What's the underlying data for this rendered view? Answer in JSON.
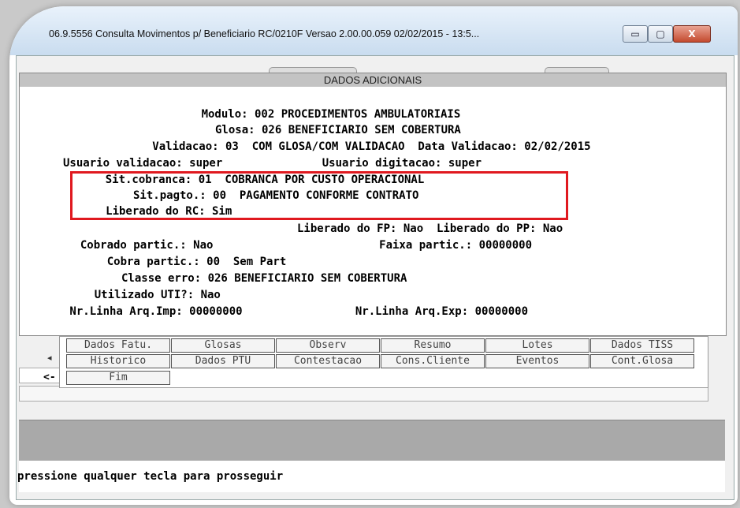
{
  "window": {
    "title": "06.9.5556 Consulta Movimentos p/ Beneficiario RC/0210F Versao 2.00.00.059 02/02/2015 - 13:5...",
    "minimize": "▭",
    "maximize": "▢",
    "close": "X"
  },
  "dialog": {
    "title": "DADOS ADICIONAIS",
    "lines": [
      "      Modulo: 002 PROCEDIMENTOS AMBULATORIAIS",
      "       Glosa: 026 BENEFICIARIO SEM COBERTURA",
      "   Validacao: 03  COM GLOSA/COM VALIDACAO  Data Validacao: 02/02/2015",
      "Usuario validacao: super               Usuario digitacao: super",
      "    Sit.cobranca: 01  COBRANCA POR CUSTO OPERACIONAL",
      "       Sit.pagto.: 00  PAGAMENTO CONFORME CONTRATO",
      "     Liberado do RC: Sim",
      "                     Liberado do FP: Nao  Liberado do PP: Nao",
      "  Cobrado partic.: Nao                         Faixa partic.: 00000000",
      "    Cobra partic.: 00  Sem Part",
      "       Classe erro: 026 BENEFICIARIO SEM COBERTURA",
      "    Utilizado UTI?: Nao",
      " Nr.Linha Arq.Imp: 00000000                 Nr.Linha Arq.Exp: 00000000"
    ]
  },
  "tabs_row1": [
    "Dados Fatu.",
    "Glosas",
    "Observ",
    "Resumo",
    "Lotes",
    "Dados TISS"
  ],
  "tabs_row2": [
    "Historico",
    "Dados PTU",
    "Contestacao",
    "Cons.Cliente",
    "Eventos",
    "Cont.Glosa"
  ],
  "tabs_row3": [
    "Fim"
  ],
  "nav": {
    "scroll_left": "◂",
    "back": "<-"
  },
  "status": {
    "text": "pressione qualquer tecla para prosseguir"
  }
}
